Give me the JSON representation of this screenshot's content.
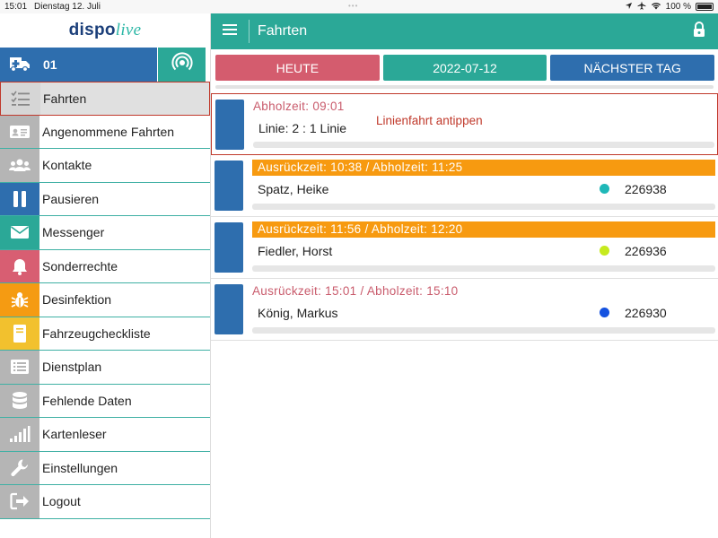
{
  "status": {
    "time": "15:01",
    "date": "Dienstag 12. Juli",
    "battery": "100 %"
  },
  "app": {
    "logo_main": "dispo",
    "logo_accent": "live"
  },
  "vehicle": {
    "number": "01"
  },
  "sidebar": {
    "items": [
      {
        "label": "Fahrten",
        "icon": "list-check-icon",
        "color": "#d6d6d6"
      },
      {
        "label": "Angenommene Fahrten",
        "icon": "id-card-icon",
        "color": "#b5b5b5"
      },
      {
        "label": "Kontakte",
        "icon": "users-icon",
        "color": "#b5b5b5"
      },
      {
        "label": "Pausieren",
        "icon": "pause-icon",
        "color": "#2e6eae"
      },
      {
        "label": "Messenger",
        "icon": "envelope-icon",
        "color": "#2ba897"
      },
      {
        "label": "Sonderrechte",
        "icon": "bell-icon",
        "color": "#d85e72"
      },
      {
        "label": "Desinfektion",
        "icon": "bug-icon",
        "color": "#f59b12"
      },
      {
        "label": "Fahrzeugcheckliste",
        "icon": "book-icon",
        "color": "#f2c12e"
      },
      {
        "label": "Dienstplan",
        "icon": "list-icon",
        "color": "#b5b5b5"
      },
      {
        "label": "Fehlende Daten",
        "icon": "database-icon",
        "color": "#b5b5b5"
      },
      {
        "label": "Kartenleser",
        "icon": "signal-bars-icon",
        "color": "#b5b5b5"
      },
      {
        "label": "Einstellungen",
        "icon": "wrench-icon",
        "color": "#b5b5b5"
      },
      {
        "label": "Logout",
        "icon": "logout-icon",
        "color": "#b5b5b5"
      }
    ]
  },
  "header": {
    "title": "Fahrten"
  },
  "day_nav": {
    "today": "HEUTE",
    "date": "2022-07-12",
    "next": "NÄCHSTER TAG"
  },
  "trips": [
    {
      "time": "Abholzeit: 09:01",
      "name": "Linie: 2 : 1 Linie",
      "hint": "Linienfahrt antippen"
    },
    {
      "time": "Ausrückzeit: 10:38 / Abholzeit: 11:25",
      "name": "Spatz, Heike",
      "number": "226938",
      "dot_color": "#1fb8b8"
    },
    {
      "time": "Ausrückzeit: 11:56 / Abholzeit: 12:20",
      "name": "Fiedler, Horst",
      "number": "226936",
      "dot_color": "#c6ea1e"
    },
    {
      "time": "Ausrückzeit: 15:01 / Abholzeit: 15:10",
      "name": "König, Markus",
      "number": "226930",
      "dot_color": "#1452e0"
    }
  ],
  "colors": {
    "accent": "#2ba897",
    "blue": "#2e6eae",
    "red": "#d45c6e",
    "orange": "#f79a10"
  }
}
